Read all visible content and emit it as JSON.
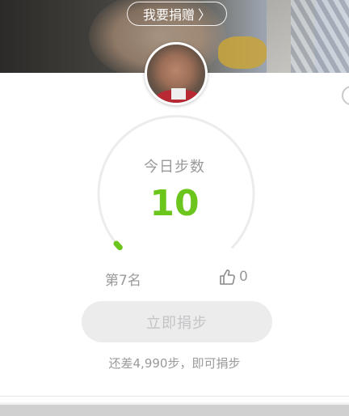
{
  "banner": {
    "donate_label": "我要捐赠",
    "chevron": "〉"
  },
  "profile": {
    "avatar_icon": "user-avatar"
  },
  "steps": {
    "label": "今日步数",
    "count": "10",
    "progress_fraction": 0.002,
    "accent_color": "#6cc51c"
  },
  "stats": {
    "rank": "第7名",
    "likes": "0"
  },
  "actions": {
    "donate_steps_label": "立即捐步"
  },
  "hint": {
    "remaining_text": "还差4,990步，即可捐步"
  },
  "icons": {
    "like": "thumbs-up-icon",
    "side": "circle-icon"
  }
}
